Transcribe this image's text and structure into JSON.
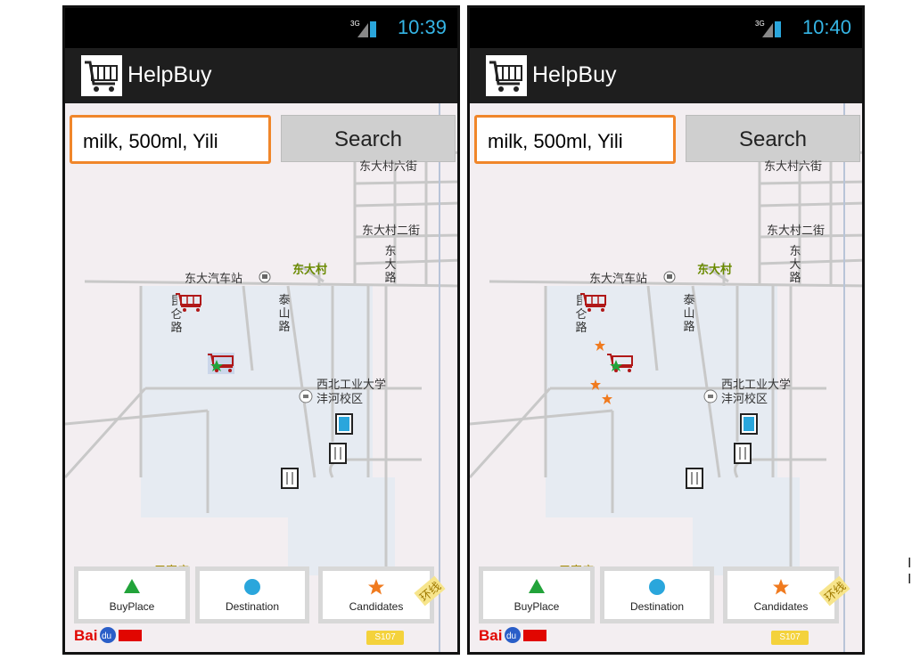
{
  "screens": [
    {
      "status": {
        "time": "10:39",
        "network": "3G"
      },
      "app": {
        "title": "HelpBuy"
      },
      "search": {
        "value": "milk, 500ml, Yili",
        "button_label": "Search"
      },
      "map": {
        "labels": {
          "street_6": "东大村六街",
          "street_2": "东大村二街",
          "dongda_road": "东大路",
          "bus_station": "东大汽车站",
          "village": "东大村",
          "kunlun_road": "昆仑路",
          "taishan_road": "泰山路",
          "university": "西北工业大学沣河校区",
          "sanjiazhuang": "三家庄",
          "ring": "环线",
          "highway": "S107"
        },
        "candidates_shown": 0
      },
      "legend": [
        {
          "label": "BuyPlace",
          "icon": "green-triangle"
        },
        {
          "label": "Destination",
          "icon": "blue-circle"
        },
        {
          "label": "Candidates",
          "icon": "orange-star"
        }
      ],
      "logo": "Baidu地图"
    },
    {
      "status": {
        "time": "10:40",
        "network": "3G"
      },
      "app": {
        "title": "HelpBuy"
      },
      "search": {
        "value": "milk, 500ml, Yili",
        "button_label": "Search"
      },
      "map": {
        "labels": {
          "street_6": "东大村六街",
          "street_2": "东大村二街",
          "dongda_road": "东大路",
          "bus_station": "东大汽车站",
          "village": "东大村",
          "kunlun_road": "昆仑路",
          "taishan_road": "泰山路",
          "university": "西北工业大学沣河校区",
          "sanjiazhuang": "三家庄",
          "ring": "环线",
          "highway": "S107"
        },
        "candidates_shown": 3
      },
      "legend": [
        {
          "label": "BuyPlace",
          "icon": "green-triangle"
        },
        {
          "label": "Destination",
          "icon": "blue-circle"
        },
        {
          "label": "Candidates",
          "icon": "orange-star"
        }
      ],
      "logo": "Baidu地图"
    }
  ],
  "colors": {
    "status_time": "#35b5e5",
    "search_border": "#f0862a",
    "buyplace": "#22a33a",
    "destination": "#2aa6dc",
    "candidate": "#f07a1e"
  },
  "side_text": "I I"
}
